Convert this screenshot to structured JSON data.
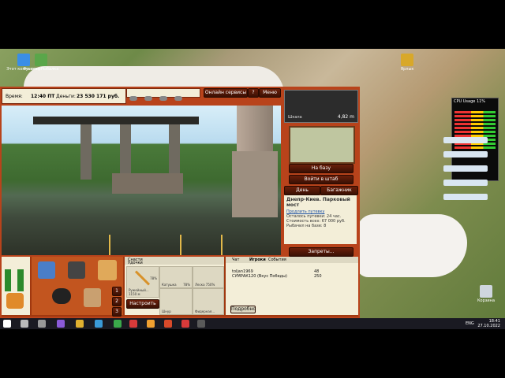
{
  "desktop": {
    "icons": [
      {
        "label": "Этот компьютер"
      },
      {
        "label": "Русская Рыбалка"
      },
      {
        "label": "Корзина"
      },
      {
        "label": "Ярлык"
      }
    ],
    "cpu_gadget": {
      "title": "CPU Usage",
      "value": "11%"
    }
  },
  "game": {
    "top": {
      "time": "12:40 ПТ",
      "money_label": "Деньги:",
      "money": "23 530 171 руб.",
      "name_label": "Время:"
    },
    "buttons": {
      "online": "Онлайн сервисы",
      "help": "?",
      "menu": "Меню"
    },
    "minimap": {
      "distance": "4,82 m",
      "label": "Шкала"
    },
    "nav_buttons": {
      "base": "На базу",
      "bag": "Войти в штаб"
    },
    "tabs": {
      "day": "День",
      "luggage": "Багажник"
    },
    "location": {
      "title": "Днепр-Киев. Парковый мост",
      "extend_link": "Продлить путевку",
      "remaining": "Осталось путевки: 24 час.",
      "cost": "Стоимость всех: 67 000 руб.",
      "fish": "Рыбачил на базе: 8"
    },
    "zaprety": "Запреты...",
    "tackle": {
      "header1": "Снасти",
      "header2": "Удочки",
      "slot1": "Фидерная...",
      "slot2": "Катушка",
      "slot3": "Шнур",
      "slot4": "Леска 750%",
      "rod_name": "Ружейный...",
      "rod_len": "1150 м",
      "pct1": "78%",
      "pct2": "78%",
      "btn_settings": "Настроить",
      "num1": "1",
      "num2": "2",
      "num3": "3"
    },
    "chat": {
      "tabs": [
        "Чат",
        "Игроки",
        "События"
      ],
      "players": [
        {
          "name": "toljan1969",
          "val": "48"
        },
        {
          "name": "СУМРАК120 (Вкус Победы)",
          "val": "250"
        }
      ],
      "btn": "Подробно"
    }
  },
  "taskbar": {
    "lang": "ENG",
    "time": "18:41",
    "date": "27.10.2022"
  },
  "colors": {
    "panel": "#b8431b",
    "panel_light": "#f3eed8",
    "button": "#4a1607"
  }
}
